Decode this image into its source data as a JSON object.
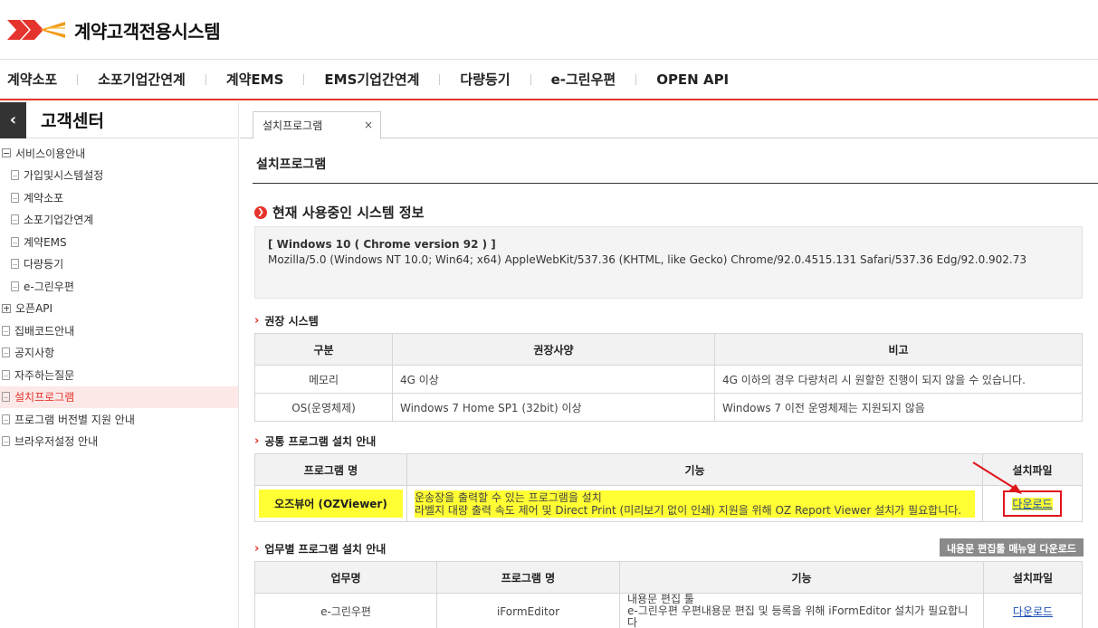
{
  "header": {
    "logo_text": "계약고객전용시스템",
    "logo_icon": "post-logo-icon"
  },
  "gnb": [
    "계약소포",
    "소포기업간연계",
    "계약EMS",
    "EMS기업간연계",
    "다량등기",
    "e-그린우편",
    "OPEN API"
  ],
  "sidebar": {
    "title": "고객센터",
    "back_icon": "chevron-left-icon",
    "items": [
      {
        "label": "서비스이용안내",
        "type": "folder-open",
        "child": false,
        "active": false
      },
      {
        "label": "가입및시스템설정",
        "type": "doc",
        "child": true,
        "active": false
      },
      {
        "label": "계약소포",
        "type": "doc",
        "child": true,
        "active": false
      },
      {
        "label": "소포기업간연계",
        "type": "doc",
        "child": true,
        "active": false
      },
      {
        "label": "계약EMS",
        "type": "doc",
        "child": true,
        "active": false
      },
      {
        "label": "다량등기",
        "type": "doc",
        "child": true,
        "active": false
      },
      {
        "label": "e-그린우편",
        "type": "doc",
        "child": true,
        "active": false
      },
      {
        "label": "오픈API",
        "type": "folder-closed",
        "child": false,
        "active": false
      },
      {
        "label": "집배코드안내",
        "type": "doc",
        "child": false,
        "active": false
      },
      {
        "label": "공지사항",
        "type": "doc",
        "child": false,
        "active": false
      },
      {
        "label": "자주하는질문",
        "type": "doc",
        "child": false,
        "active": false
      },
      {
        "label": "설치프로그램",
        "type": "doc",
        "child": false,
        "active": true
      },
      {
        "label": "프로그램 버전별 지원 안내",
        "type": "doc",
        "child": false,
        "active": false
      },
      {
        "label": "브라우저설정 안내",
        "type": "doc",
        "child": false,
        "active": false
      }
    ]
  },
  "tab": {
    "label": "설치프로그램",
    "close": "×"
  },
  "page_title": "설치프로그램",
  "system_info": {
    "heading": "현재 사용중인 시스템 정보",
    "os": "[ Windows 10 ( Chrome version 92 ) ]",
    "ua": "Mozilla/5.0 (Windows NT 10.0; Win64; x64) AppleWebKit/537.36 (KHTML, like Gecko) Chrome/92.0.4515.131 Safari/537.36 Edg/92.0.902.73"
  },
  "recommended": {
    "heading": "권장 시스템",
    "headers": [
      "구분",
      "권장사양",
      "비고"
    ],
    "rows": [
      [
        "메모리",
        "4G 이상",
        "4G 이하의 경우 다량처리 시 원할한 진행이 되지 않을 수 있습니다."
      ],
      [
        "OS(운영체제)",
        "Windows 7 Home SP1 (32bit) 이상",
        "Windows 7 이전 운영체제는 지원되지 않음"
      ]
    ]
  },
  "common": {
    "heading": "공통 프로그램 설치 안내",
    "headers": [
      "프로그램 명",
      "기능",
      "설치파일"
    ],
    "row": {
      "name": "오즈뷰어 (OZViewer)",
      "desc1": "운송장을 출력할 수 있는 프로그램을 설치",
      "desc2": "라벨지 대량 출력 속도 제어 및 Direct Print (미리보기 없이 인쇄) 지원을 위해 OZ Report Viewer 설치가 필요합니다.",
      "download": "다운로드"
    }
  },
  "business": {
    "heading": "업무별 프로그램 설치 안내",
    "manual_button": "내용문 편집툴 매뉴얼 다운로드",
    "headers": [
      "업무명",
      "프로그램 명",
      "기능",
      "설치파일"
    ],
    "row": {
      "biz": "e-그린우편",
      "program": "iFormEditor",
      "desc1": "내용문 편집 툴",
      "desc2": "e-그린우편 우편내용문 편집 및 등록을 위해 iFormEditor 설치가 필요합니다",
      "download": "다운로드"
    }
  },
  "colors": {
    "accent": "#e5342d",
    "highlight": "#ffff33",
    "link": "#1a4fb3"
  }
}
